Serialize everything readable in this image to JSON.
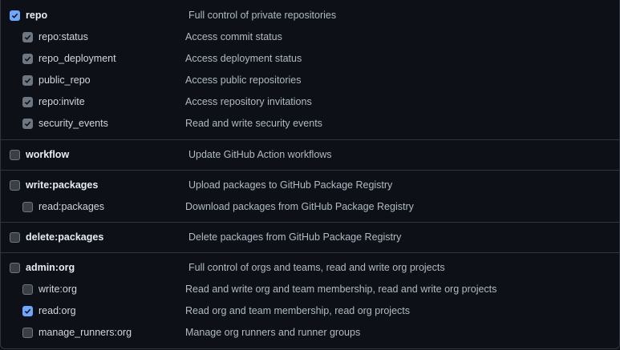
{
  "scopes": {
    "repo": {
      "name": "repo",
      "desc": "Full control of private repositories",
      "checked": true,
      "children": [
        {
          "name": "repo:status",
          "desc": "Access commit status"
        },
        {
          "name": "repo_deployment",
          "desc": "Access deployment status"
        },
        {
          "name": "public_repo",
          "desc": "Access public repositories"
        },
        {
          "name": "repo:invite",
          "desc": "Access repository invitations"
        },
        {
          "name": "security_events",
          "desc": "Read and write security events"
        }
      ]
    },
    "workflow": {
      "name": "workflow",
      "desc": "Update GitHub Action workflows"
    },
    "write_packages": {
      "name": "write:packages",
      "desc": "Upload packages to GitHub Package Registry",
      "children": [
        {
          "name": "read:packages",
          "desc": "Download packages from GitHub Package Registry"
        }
      ]
    },
    "delete_packages": {
      "name": "delete:packages",
      "desc": "Delete packages from GitHub Package Registry"
    },
    "admin_org": {
      "name": "admin:org",
      "desc": "Full control of orgs and teams, read and write org projects",
      "children": [
        {
          "name": "write:org",
          "desc": "Read and write org and team membership, read and write org projects"
        },
        {
          "name": "read:org",
          "desc": "Read org and team membership, read org projects",
          "checked": true
        },
        {
          "name": "manage_runners:org",
          "desc": "Manage org runners and runner groups"
        }
      ]
    }
  },
  "colors": {
    "checked": "#6ea8fe",
    "inherited": "#6e7681",
    "border": "#30363d"
  }
}
